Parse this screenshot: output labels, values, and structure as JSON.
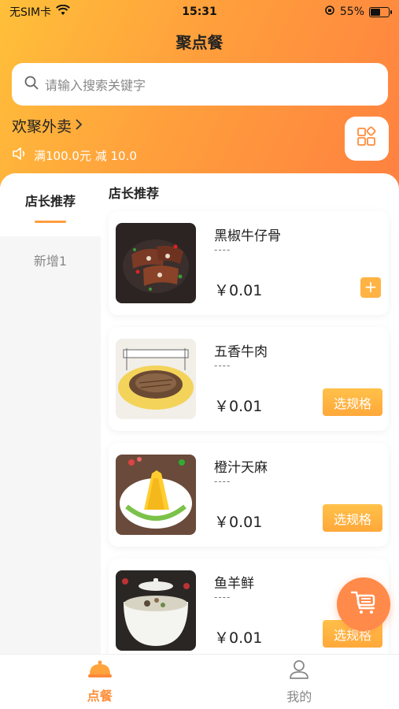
{
  "status_bar": {
    "carrier": "无SIM卡",
    "time": "15:31",
    "battery": "55%",
    "battery_level": 0.55
  },
  "app": {
    "title": "聚点餐"
  },
  "search": {
    "placeholder": "请输入搜索关键字"
  },
  "store": {
    "name": "欢聚外卖",
    "promo": "满100.0元 减 10.0"
  },
  "sidebar": {
    "items": [
      {
        "label": "店长推荐",
        "active": true
      },
      {
        "label": "新增1",
        "active": false
      }
    ]
  },
  "section": {
    "title": "店长推荐"
  },
  "products": [
    {
      "name": "黑椒牛仔骨",
      "dash": "----",
      "price": "￥0.01",
      "action": "+"
    },
    {
      "name": "五香牛肉",
      "dash": "----",
      "price": "￥0.01",
      "action": "选规格"
    },
    {
      "name": "橙汁天麻",
      "dash": "----",
      "price": "￥0.01",
      "action": "选规格"
    },
    {
      "name": "鱼羊鲜",
      "dash": "----",
      "price": "￥0.01",
      "action": "选规格"
    }
  ],
  "tabbar": {
    "items": [
      {
        "label": "点餐",
        "active": true
      },
      {
        "label": "我的",
        "active": false
      }
    ]
  },
  "colors": {
    "accent": "#ff9d3c",
    "gradient_start": "#ffc03a",
    "gradient_end": "#ff8040",
    "button": "#ffb343"
  },
  "icons": [
    "wifi-icon",
    "search-icon",
    "chevron-right-icon",
    "speaker-icon",
    "grid-icon",
    "plus-icon",
    "cart-icon",
    "dish-cover-icon",
    "user-icon"
  ]
}
